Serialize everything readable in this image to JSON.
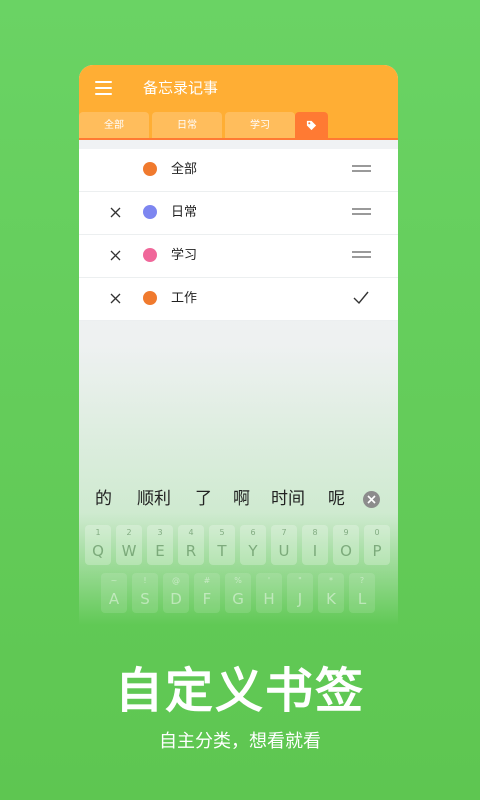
{
  "header": {
    "title": "备忘录记事"
  },
  "tabs": [
    {
      "label": "全部"
    },
    {
      "label": "日常"
    },
    {
      "label": "学习"
    },
    {
      "icon": "tag-icon"
    }
  ],
  "categories": [
    {
      "label": "全部",
      "color": "#f07a2e",
      "deletable": false,
      "action": "drag-handle-icon"
    },
    {
      "label": "日常",
      "color": "#7d86f0",
      "deletable": true,
      "action": "drag-handle-icon"
    },
    {
      "label": "学习",
      "color": "#f0679a",
      "deletable": true,
      "action": "drag-handle-icon"
    },
    {
      "label": "工作",
      "color": "#f07a2e",
      "deletable": true,
      "action": "check-icon"
    }
  ],
  "suggestions": [
    "的",
    "顺利",
    "了",
    "啊",
    "时间",
    "呢"
  ],
  "keyboard": {
    "row1": [
      {
        "sub": "1",
        "main": "Q"
      },
      {
        "sub": "2",
        "main": "W"
      },
      {
        "sub": "3",
        "main": "E"
      },
      {
        "sub": "4",
        "main": "R"
      },
      {
        "sub": "5",
        "main": "T"
      },
      {
        "sub": "6",
        "main": "Y"
      },
      {
        "sub": "7",
        "main": "U"
      },
      {
        "sub": "8",
        "main": "I"
      },
      {
        "sub": "9",
        "main": "O"
      },
      {
        "sub": "0",
        "main": "P"
      }
    ],
    "row2": [
      {
        "sub": "~",
        "main": "A"
      },
      {
        "sub": "!",
        "main": "S"
      },
      {
        "sub": "@",
        "main": "D"
      },
      {
        "sub": "#",
        "main": "F"
      },
      {
        "sub": "%",
        "main": "G"
      },
      {
        "sub": "'",
        "main": "H"
      },
      {
        "sub": "\"",
        "main": "J"
      },
      {
        "sub": "*",
        "main": "K"
      },
      {
        "sub": "?",
        "main": "L"
      }
    ]
  },
  "promo": {
    "headline": "自定义书签",
    "subline": "自主分类，想看就看"
  },
  "colors": {
    "accent": "#ff7a33",
    "header": "#ffae34",
    "background": "#62cb58"
  }
}
